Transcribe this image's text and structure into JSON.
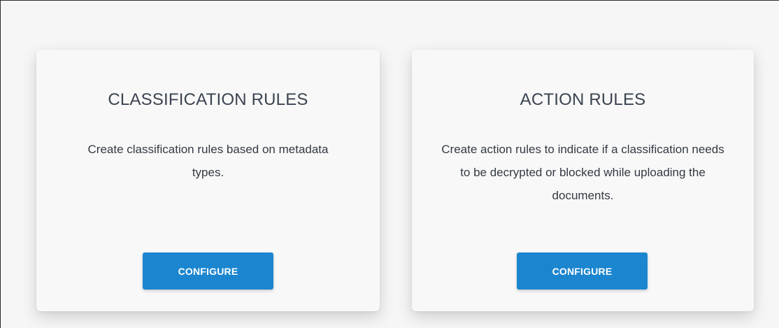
{
  "cards": [
    {
      "title": "CLASSIFICATION RULES",
      "description": "Create classification rules based on metadata types.",
      "button_label": "CONFIGURE"
    },
    {
      "title": "ACTION RULES",
      "description": "Create action rules to indicate if a classification needs to be decrypted or blocked while uploading the documents.",
      "button_label": "CONFIGURE"
    }
  ],
  "colors": {
    "button_bg": "#1b86cf",
    "title_text": "#3b4451",
    "page_bg": "#f6f6f6"
  }
}
